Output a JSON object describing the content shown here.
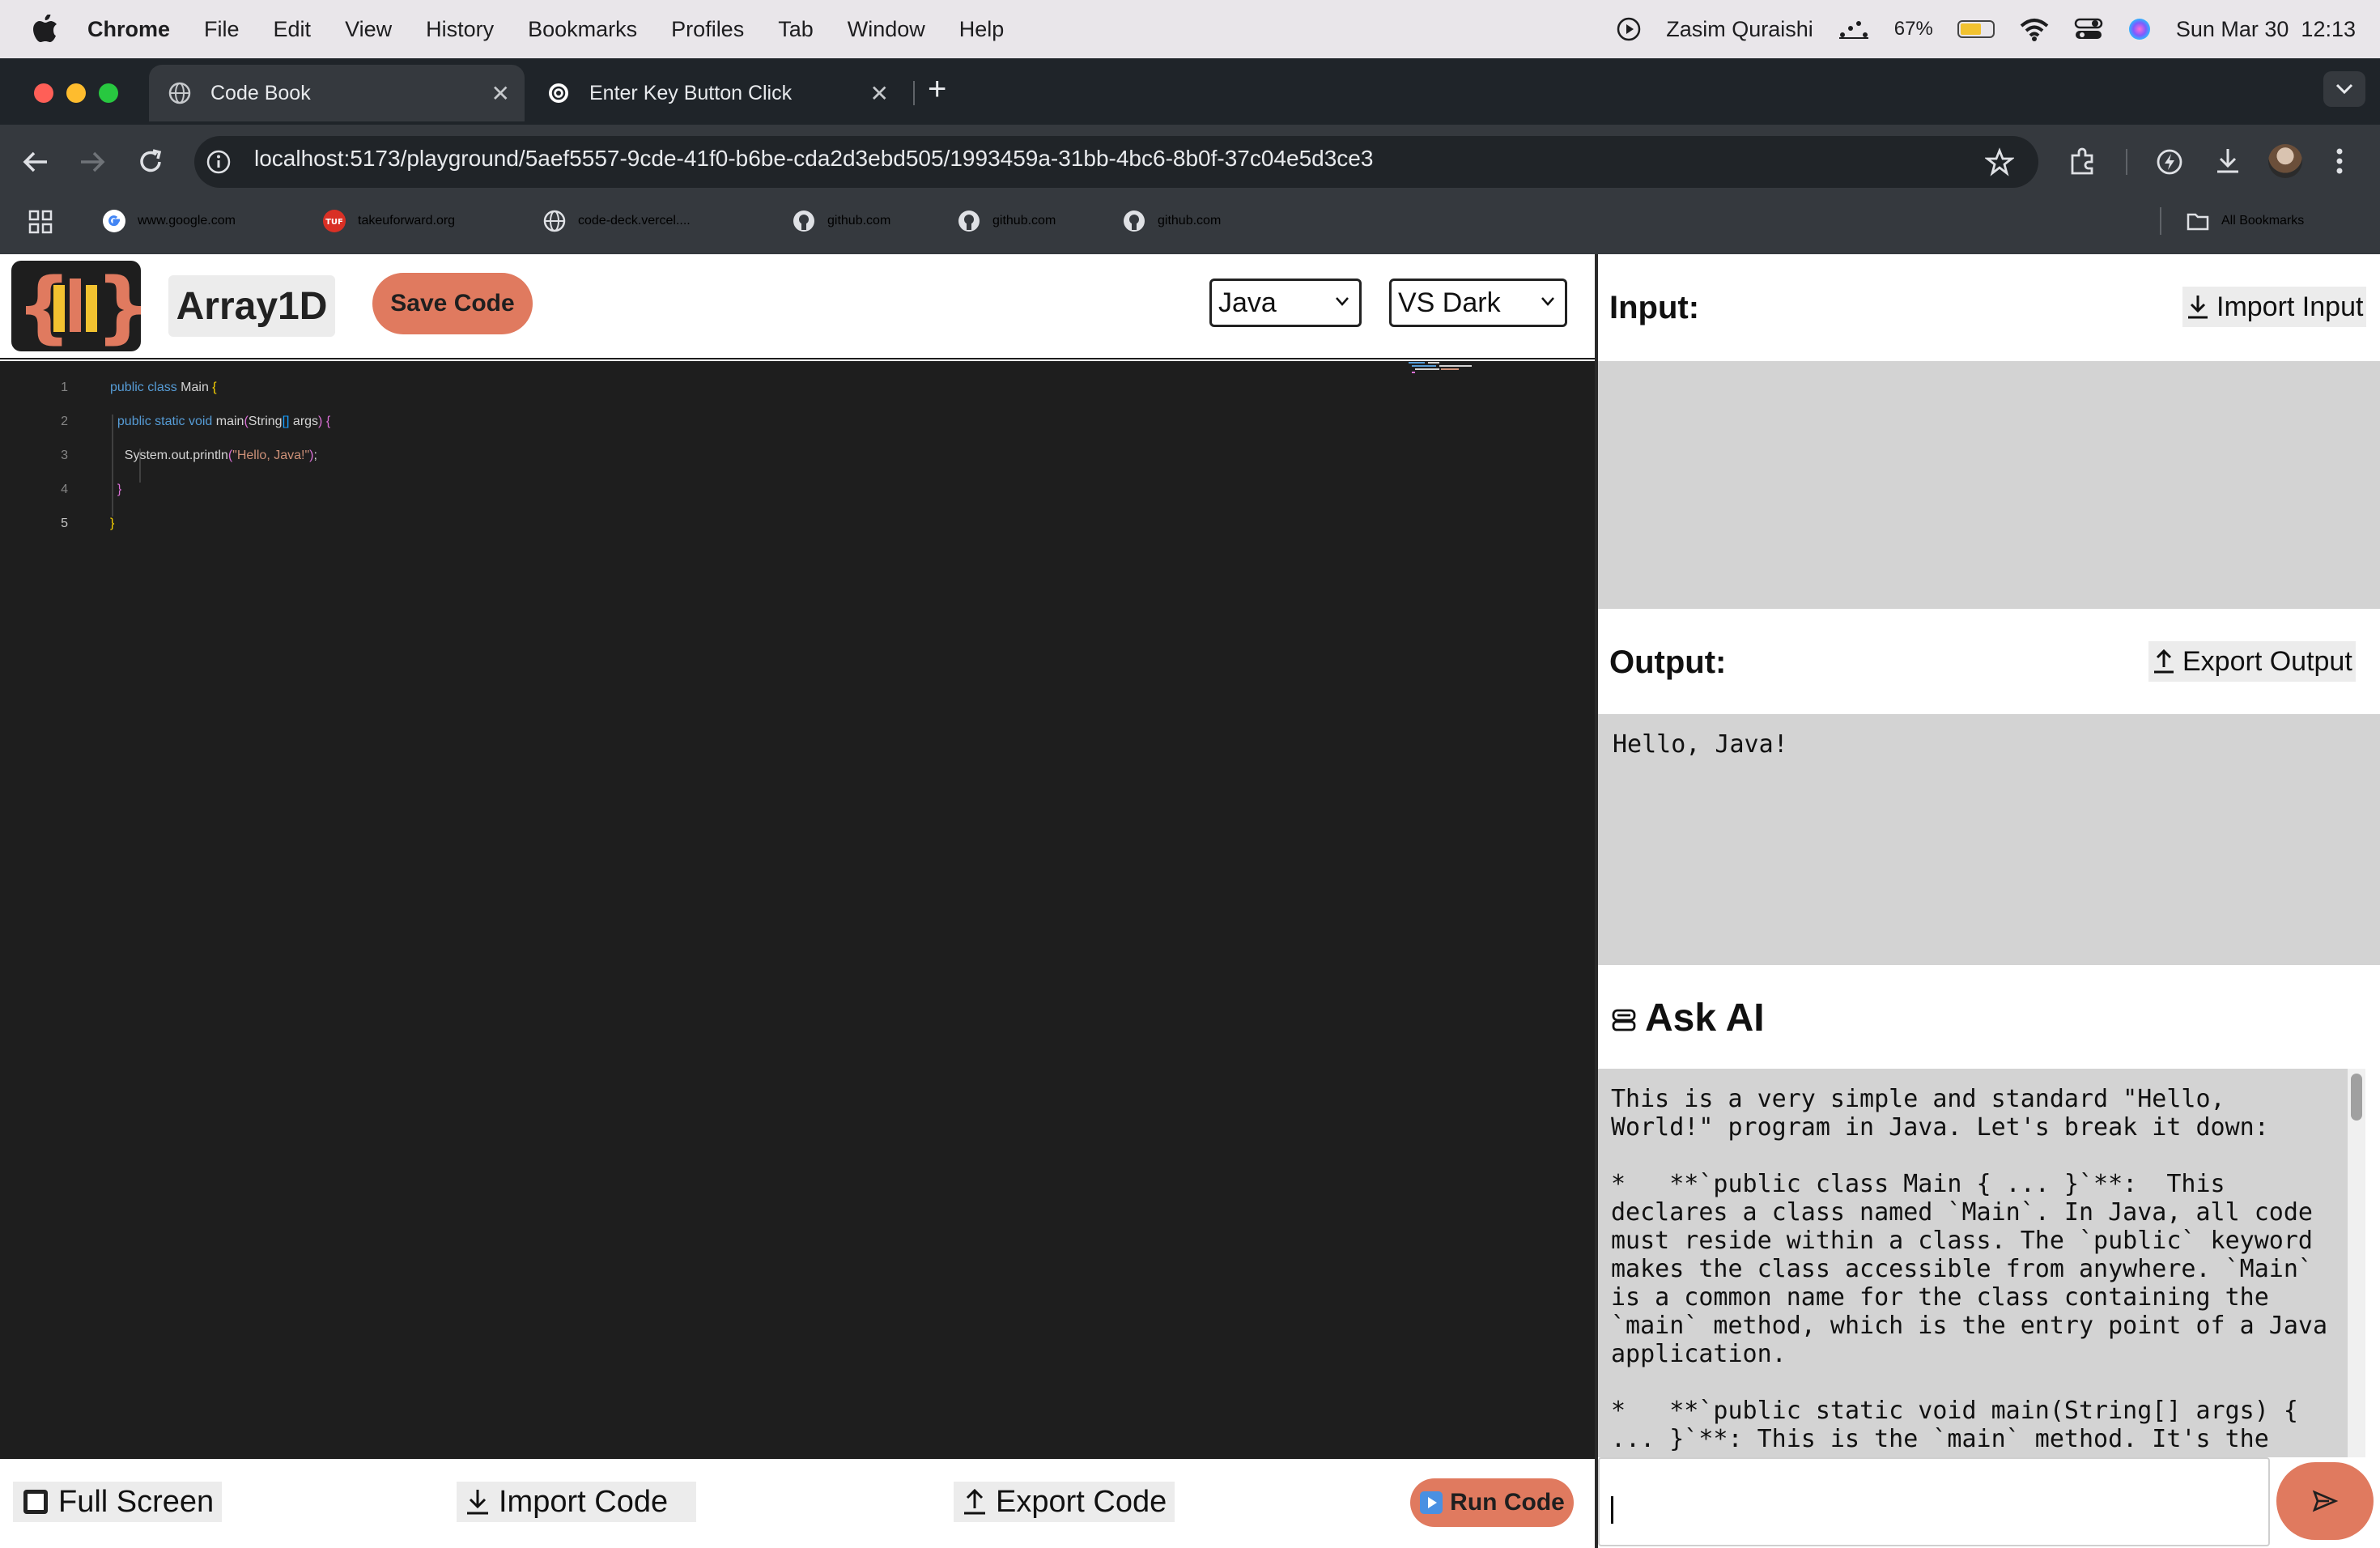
{
  "menubar": {
    "items": [
      "Chrome",
      "File",
      "Edit",
      "View",
      "History",
      "Bookmarks",
      "Profiles",
      "Tab",
      "Window",
      "Help"
    ],
    "user": "Zasim Quraishi",
    "battery_text": "67%",
    "battery_level": 0.67,
    "datetime": "Sun Mar 30  12:13"
  },
  "browser": {
    "tabs": [
      {
        "title": "Code Book",
        "icon": "globe-icon",
        "active": true
      },
      {
        "title": "Enter Key Button Click",
        "icon": "openai-icon",
        "active": false
      }
    ],
    "url": "localhost:5173/playground/5aef5557-9cde-41f0-b6be-cda2d3ebd505/1993459a-31bb-4bc6-8b0f-37c04e5d3ce3",
    "bookmarks": [
      {
        "label": "www.google.com",
        "icon": "google-icon"
      },
      {
        "label": "takeuforward.org",
        "icon": "tuf-icon"
      },
      {
        "label": "code-deck.vercel....",
        "icon": "globe-icon"
      },
      {
        "label": "github.com",
        "icon": "github-icon"
      },
      {
        "label": "github.com",
        "icon": "github-icon"
      },
      {
        "label": "github.com",
        "icon": "github-icon"
      }
    ],
    "all_bookmarks": "All Bookmarks"
  },
  "editor": {
    "title": "Array1D",
    "save_label": "Save Code",
    "language": "Java",
    "theme": "VS Dark",
    "line_numbers": [
      "1",
      "2",
      "3",
      "4",
      "5"
    ],
    "code_lines": [
      "public class Main {",
      "  public static void main(String[] args) {",
      "    System.out.println(\"Hello, Java!\");",
      "  }",
      "}"
    ]
  },
  "bottom": {
    "fullscreen_label": "Full Screen",
    "import_label": "Import Code",
    "export_label": "Export Code",
    "run_label": "Run Code"
  },
  "input_panel": {
    "label": "Input:",
    "import_label": "Import Input",
    "value": ""
  },
  "output_panel": {
    "label": "Output:",
    "export_label": "Export Output",
    "value": "Hello, Java!"
  },
  "ask_ai": {
    "title": "Ask AI",
    "response": "This is a very simple and standard \"Hello, World!\" program in Java. Let's break it down:\n\n*   **`public class Main { ... }`**:  This declares a class named `Main`. In Java, all code must reside within a class. The `public` keyword makes the class accessible from anywhere. `Main` is a common name for the class containing the `main` method, which is the entry point of a Java application.\n\n*   **`public static void main(String[] args) { ... }`**: This is the `main` method. It's the",
    "input_value": ""
  },
  "colors": {
    "accent": "#e07a5f",
    "editor_bg": "#1e1e1e",
    "panel_bg": "#d3d3d3",
    "chrome_dark": "#35393e"
  }
}
